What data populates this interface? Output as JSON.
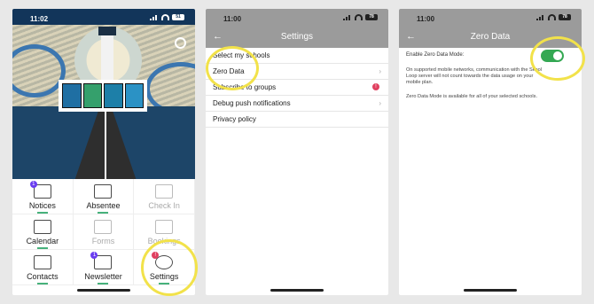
{
  "phone1": {
    "time": "11:02",
    "battery": "51",
    "tiles": [
      {
        "label": "Notices",
        "icon": "notices-icon",
        "badge": "1",
        "underline": true,
        "dim": false
      },
      {
        "label": "Absentee",
        "icon": "envelope-icon",
        "badge": "",
        "underline": true,
        "dim": false
      },
      {
        "label": "Check In",
        "icon": "location-pin-icon",
        "badge": "",
        "underline": false,
        "dim": true
      },
      {
        "label": "Calendar",
        "icon": "calendar-icon",
        "badge": "",
        "underline": true,
        "dim": false
      },
      {
        "label": "Forms",
        "icon": "forms-icon",
        "badge": "",
        "underline": false,
        "dim": true
      },
      {
        "label": "Bookings",
        "icon": "bookings-icon",
        "badge": "",
        "underline": false,
        "dim": true
      },
      {
        "label": "Contacts",
        "icon": "contacts-icon",
        "badge": "",
        "underline": true,
        "dim": false
      },
      {
        "label": "Newsletter",
        "icon": "newsletter-icon",
        "badge": "1",
        "underline": true,
        "dim": false
      },
      {
        "label": "Settings",
        "icon": "gear-icon",
        "badge": "!",
        "underline": true,
        "dim": false
      }
    ]
  },
  "phone2": {
    "time": "11:00",
    "battery": "78",
    "title": "Settings",
    "items": [
      {
        "label": "Select my schools",
        "chevron": false,
        "error": false
      },
      {
        "label": "Zero Data",
        "chevron": true,
        "error": false
      },
      {
        "label": "Subscribe to groups",
        "chevron": false,
        "error": true
      },
      {
        "label": "Debug push notifications",
        "chevron": true,
        "error": false
      },
      {
        "label": "Privacy policy",
        "chevron": false,
        "error": false
      }
    ]
  },
  "phone3": {
    "time": "11:00",
    "battery": "78",
    "title": "Zero Data",
    "toggle_label": "Enable Zero Data Mode:",
    "toggle_on": true,
    "para1": "On supported mobile networks, communication with the Skool Loop server will not count towards the data usage on your mobile plan.",
    "para2": "Zero Data Mode is available for all of your selected schools."
  },
  "colors": {
    "accent_green": "#34a853",
    "highlight_yellow": "#f2e24a",
    "nav_grey": "#9b9b9b"
  }
}
